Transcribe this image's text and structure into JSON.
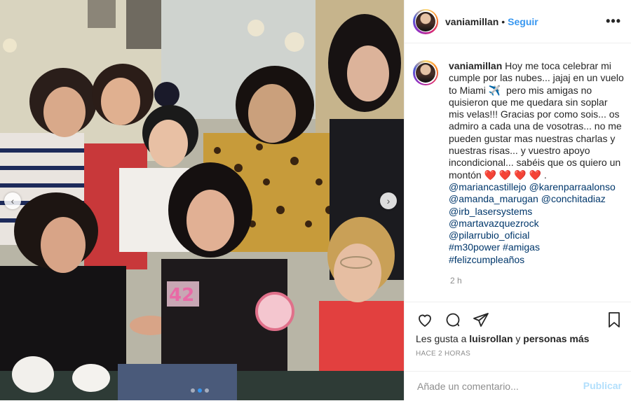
{
  "post": {
    "username": "vaniamillan",
    "separator": "•",
    "follow_label": "Seguir",
    "more_icon": "more-icon",
    "caption_text": "Hoy me toca celebrar mi cumple por las nubes... jajaj en un vuelo to Miami ✈️  pero mis amigas no quisieron que me quedara sin soplar mis velas!!! Gracias por como sois... os admiro a cada una de vosotras... no me pueden gustar mas nuestras charlas y nuestras risas... y vuestro apoyo incondicional... sabéis que os quiero un montón ❤️ ❤️ ❤️ ❤️ .",
    "mentions": [
      "@mariancastillejo @karenparraalonso",
      "@amanda_marugan @conchitadiaz",
      "@irb_lasersystems",
      "@martavazquezrock",
      "@pilarrubio_oficial",
      "#m30power #amigas",
      "#felizcumpleaños"
    ],
    "time_ago": "2 h",
    "likes_prefix": "Les gusta a",
    "likes_user": "luisrollan",
    "likes_middle": "y",
    "likes_others": "personas más",
    "posted_ago": "HACE 2 HORAS",
    "comment_placeholder": "Añade un comentario...",
    "publish_label": "Publicar"
  },
  "photo": {
    "candle_number": "42",
    "carousel_total": 3,
    "carousel_active": 2
  },
  "colors": {
    "link_blue": "#3897f0",
    "mention_blue": "#00376b",
    "publish_disabled": "#b2dffc",
    "heart_red": "#e0245e"
  }
}
